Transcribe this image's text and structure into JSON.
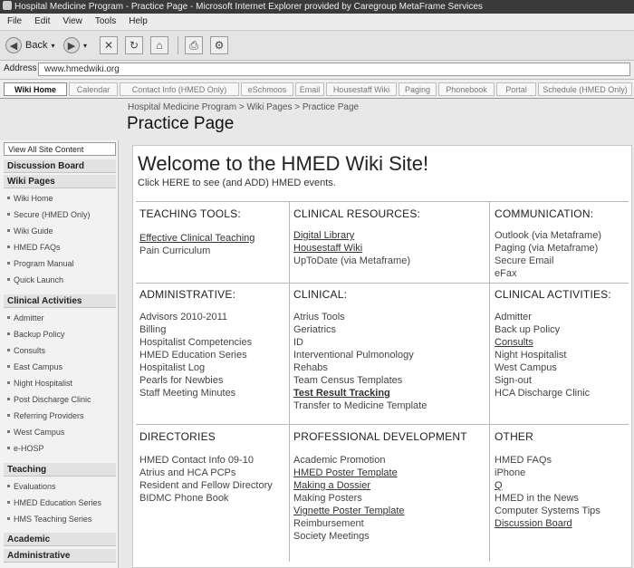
{
  "window": {
    "title": "Hospital Medicine Program - Practice Page - Microsoft Internet Explorer provided by Caregroup MetaFrame Services"
  },
  "menu": [
    "File",
    "Edit",
    "View",
    "Tools",
    "Help"
  ],
  "toolbar": {
    "back_label": "Back"
  },
  "address": {
    "label": "Address",
    "value": "www.hmedwiki.org"
  },
  "tabs": [
    "Wiki Home",
    "Calendar",
    "Contact Info (HMED Only)",
    "eSchmoos",
    "Email",
    "Housestaff Wiki",
    "Paging",
    "Phonebook",
    "Portal",
    "Schedule (HMED Only)"
  ],
  "breadcrumb": "Hospital Medicine Program > Wiki Pages > Practice Page",
  "page_title": "Practice Page",
  "nav": {
    "view_all": "View All Site Content",
    "discussion": "Discussion Board",
    "wiki_pages": {
      "title": "Wiki Pages",
      "items": [
        "Wiki Home",
        "Secure (HMED Only)",
        "Wiki Guide",
        "HMED FAQs",
        "Program Manual",
        "Quick Launch"
      ]
    },
    "clinical": {
      "title": "Clinical Activities",
      "items": [
        "Admitter",
        "Backup Policy",
        "Consults",
        "East Campus",
        "Night Hospitalist",
        "Post Discharge Clinic",
        "Referring Providers",
        "West Campus",
        "e-HOSP"
      ]
    },
    "teaching": {
      "title": "Teaching",
      "items": [
        "Evaluations",
        "HMED Education Series",
        "HMS Teaching Series"
      ]
    },
    "academic": "Academic",
    "administrative": "Administrative"
  },
  "welcome": "Welcome to the HMED Wiki Site!",
  "click_here": "Click HERE to see (and ADD) HMED events.",
  "sections": {
    "teaching_tools": {
      "title": "TEACHING TOOLS:",
      "items": [
        "Effective Clinical Teaching",
        "Pain Curriculum"
      ]
    },
    "clinical_resources": {
      "title": "CLINICAL RESOURCES:",
      "items": [
        "Digital Library",
        "Housestaff Wiki",
        "UpToDate (via Metaframe)"
      ]
    },
    "communication": {
      "title": "COMMUNICATION:",
      "items": [
        "Outlook (via Metaframe)",
        "Paging (via Metaframe)",
        "Secure Email",
        "eFax"
      ]
    },
    "administrative": {
      "title": "ADMINISTRATIVE:",
      "items": [
        "Advisors 2010-2011",
        "Billing",
        "Hospitalist Competencies",
        "HMED Education Series",
        "Hospitalist Log",
        "Pearls for Newbies",
        "Staff Meeting Minutes"
      ]
    },
    "clinical": {
      "title": "CLINICAL:",
      "items": [
        "Atrius Tools",
        "Geriatrics",
        "ID",
        "Interventional Pulmonology",
        "Rehabs",
        "Team Census Templates",
        "Test Result Tracking",
        "Transfer to Medicine Template"
      ]
    },
    "clinical_activities": {
      "title": "CLINICAL ACTIVITIES:",
      "items": [
        "Admitter",
        "Back up Policy",
        "Consults",
        "Night Hospitalist",
        "West Campus",
        "Sign-out",
        "HCA Discharge Clinic"
      ]
    },
    "directories": {
      "title": "DIRECTORIES",
      "items": [
        "HMED Contact Info 09-10",
        "Atrius and HCA PCPs",
        "Resident and Fellow Directory",
        "BIDMC Phone Book"
      ]
    },
    "professional_development": {
      "title": "PROFESSIONAL DEVELOPMENT",
      "items": [
        "Academic Promotion",
        "HMED Poster Template",
        "Making a Dossier",
        "Making Posters",
        "Vignette Poster Template",
        "Reimbursement",
        "Society Meetings"
      ]
    },
    "other": {
      "title": "OTHER",
      "items": [
        "HMED FAQs",
        "iPhone",
        "Q",
        "HMED in the News",
        "Computer Systems Tips",
        "Discussion Board"
      ]
    }
  }
}
